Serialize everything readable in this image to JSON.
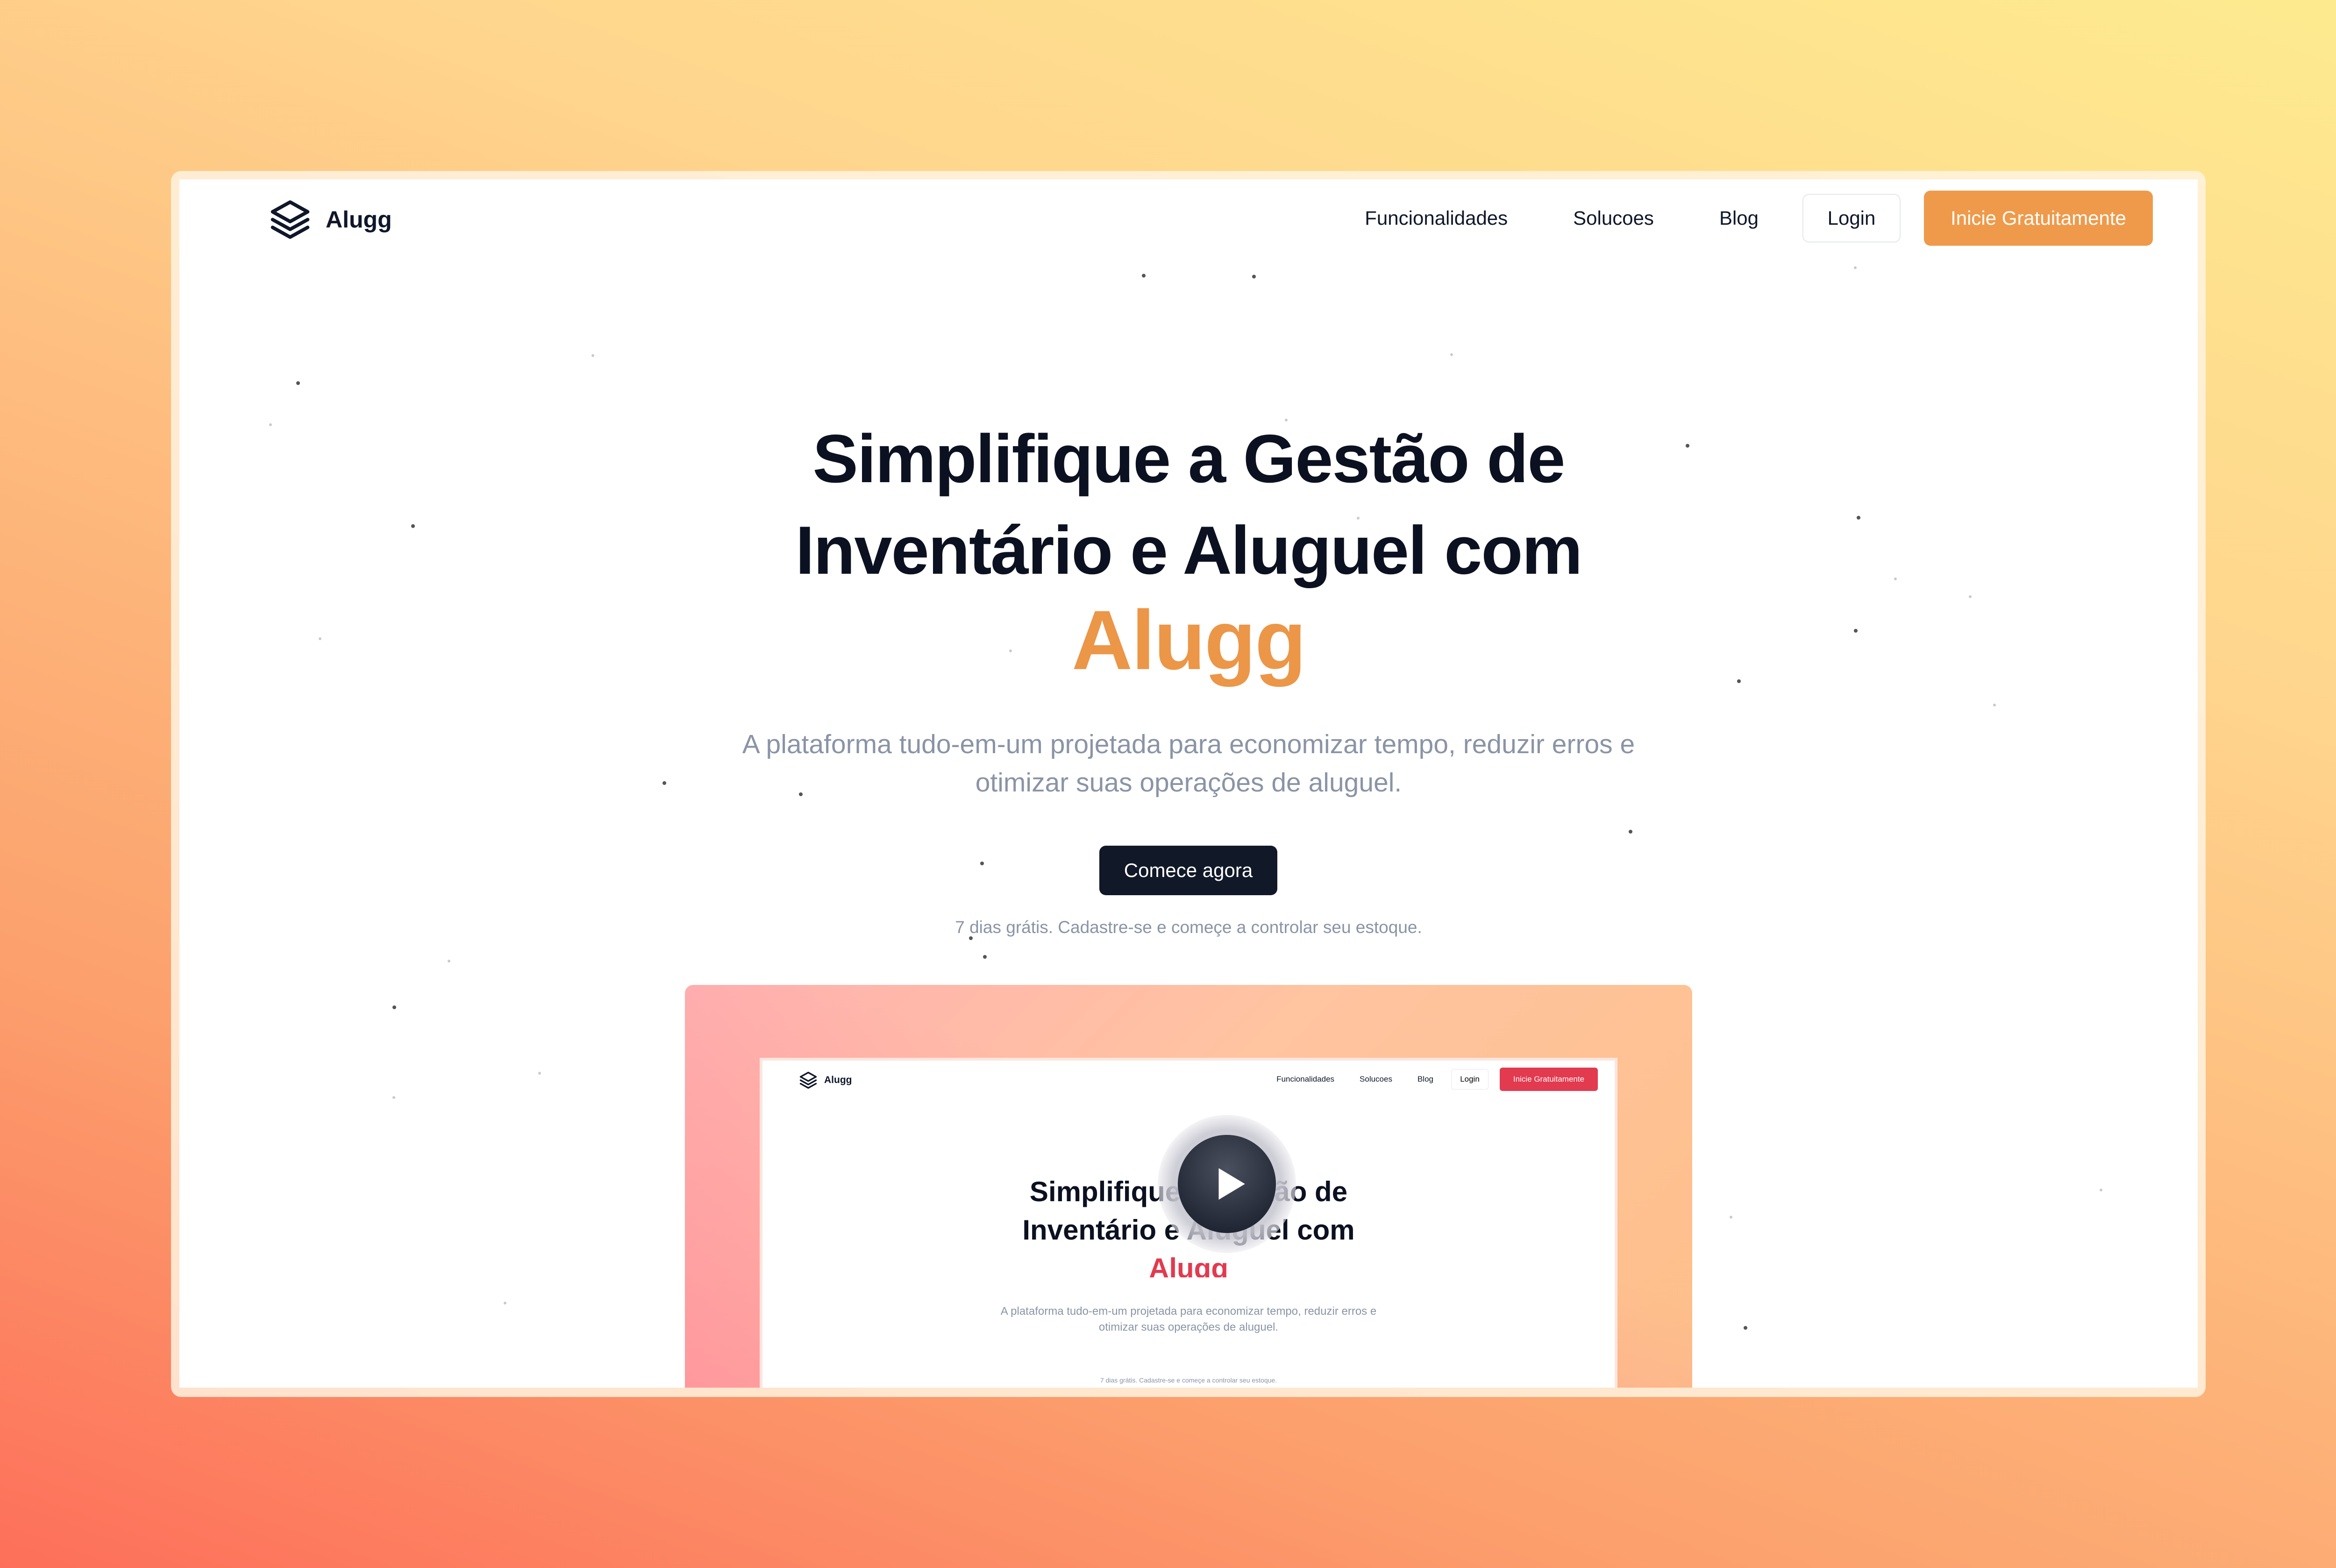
{
  "nav": {
    "brand": "Alugg",
    "links": [
      "Funcionalidades",
      "Solucoes",
      "Blog"
    ],
    "login_label": "Login",
    "cta_label": "Inicie Gratuitamente"
  },
  "hero": {
    "title_line1": "Simplifique a Gestão de",
    "title_line2": "Inventário e Aluguel com",
    "title_accent": "Alugg",
    "subtitle_line1": "A plataforma tudo-em-um projetada para economizar tempo, reduzir erros e",
    "subtitle_line2": "otimizar suas operações de aluguel.",
    "cta_label": "Comece agora",
    "note": "7 dias grátis. Cadastre-se e começe a controlar seu estoque."
  },
  "preview": {
    "brand": "Alugg",
    "links": [
      "Funcionalidades",
      "Solucoes",
      "Blog"
    ],
    "login_label": "Login",
    "cta_label": "Inicie Gratuitamente",
    "title_line1": "Simplifique a Gestão de",
    "title_line2": "Inventário e Aluguel com",
    "title_accent": "Alugg",
    "subtitle_line1": "A plataforma tudo-em-um projetada para economizar tempo, reduzir erros e",
    "subtitle_line2": "otimizar suas operações de aluguel.",
    "note": "7 dias grátis. Cadastre-se e começe a controlar seu estoque.",
    "play_icon": "play-icon"
  },
  "colors": {
    "accent": "#ec9648",
    "cta": "#ef9a4a",
    "dark_button": "#111827",
    "preview_accent": "#e23a4f"
  }
}
